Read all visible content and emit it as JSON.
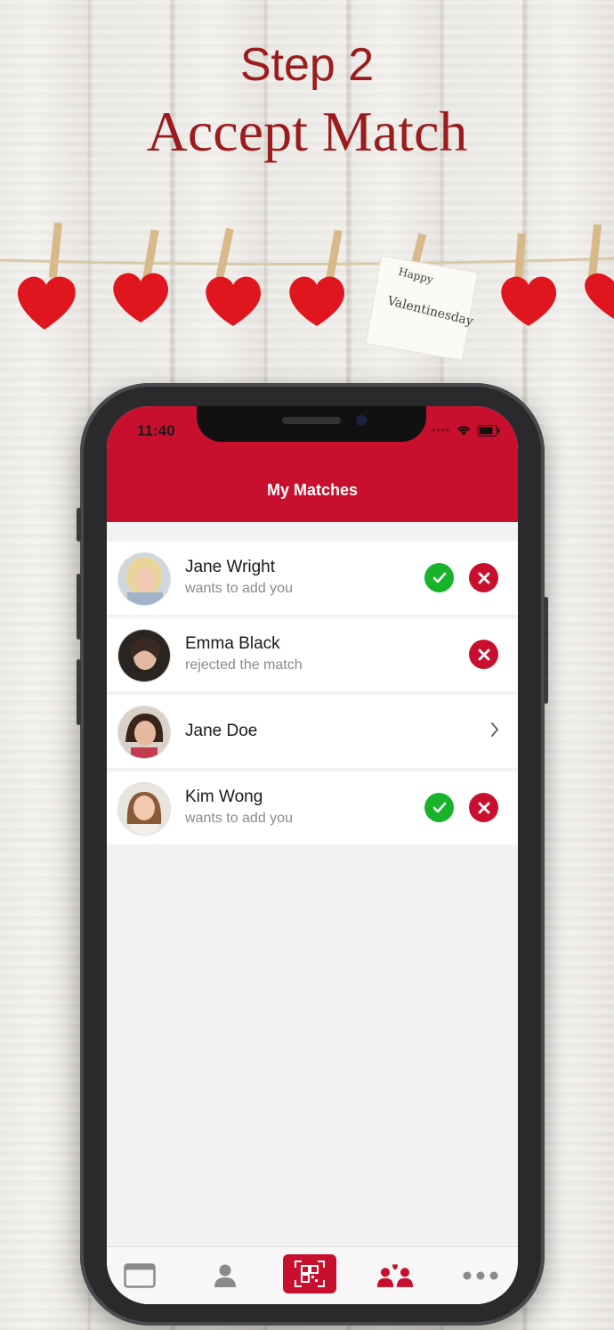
{
  "promo": {
    "step": "Step 2",
    "headline": "Accept Match",
    "note_text": "Happy Valentinesday"
  },
  "status_bar": {
    "time": "11:40"
  },
  "screen": {
    "title": "My Matches"
  },
  "matches": [
    {
      "name": "Jane Wright",
      "status": "wants to add you",
      "actions": [
        "accept",
        "reject"
      ]
    },
    {
      "name": "Emma Black",
      "status": "rejected the match",
      "actions": [
        "reject"
      ]
    },
    {
      "name": "Jane Doe",
      "status": "",
      "actions": [
        "open"
      ]
    },
    {
      "name": "Kim Wong",
      "status": "wants to add you",
      "actions": [
        "accept",
        "reject"
      ]
    }
  ],
  "tabbar": {
    "items": [
      {
        "icon": "browser-window-icon",
        "active": false
      },
      {
        "icon": "person-icon",
        "active": false
      },
      {
        "icon": "qr-scan-icon",
        "active": true
      },
      {
        "icon": "matches-couple-icon",
        "active": false
      },
      {
        "icon": "more-dots-icon",
        "active": false
      }
    ]
  },
  "colors": {
    "brand_red": "#c8102e",
    "accept_green": "#19b32b",
    "headline_red": "#9b1c1c"
  }
}
